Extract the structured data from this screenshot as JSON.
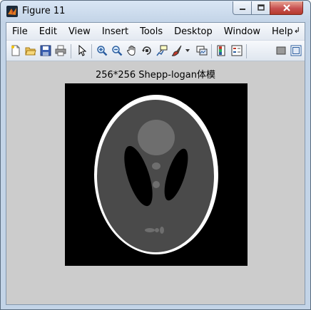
{
  "window": {
    "title": "Figure 11"
  },
  "menu": {
    "items": [
      "File",
      "Edit",
      "View",
      "Insert",
      "Tools",
      "Desktop",
      "Window",
      "Help"
    ],
    "overflow": "↲"
  },
  "toolbar": {
    "buttons": [
      "new-figure",
      "open-file",
      "save-figure",
      "print-figure",
      "edit-plot",
      "zoom-in",
      "zoom-out",
      "pan",
      "rotate-3d",
      "data-cursor",
      "brush",
      "link-plot",
      "insert-colorbar",
      "insert-legend",
      "hide-plot-tools",
      "show-plot-tools"
    ]
  },
  "figure": {
    "title": "256*256 Shepp-logan体模"
  }
}
